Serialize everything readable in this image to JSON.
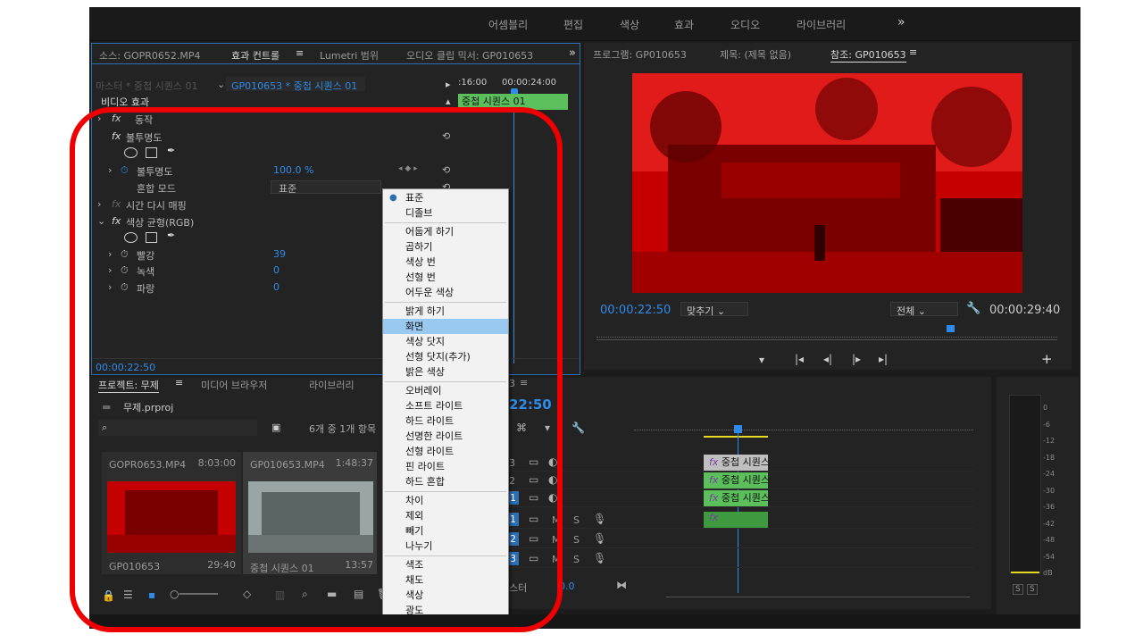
{
  "workspaces": [
    "어셈블리",
    "편집",
    "색상",
    "효과",
    "오디오",
    "라이브러리"
  ],
  "workspaces_more": "»",
  "source_panel": {
    "tabs": [
      "소스: GOPR0652.MP4",
      "효과 컨트롤",
      "Lumetri 범위",
      "오디오 클립 믹서: GP010653"
    ],
    "active_tab_menu": "≡",
    "more": "»",
    "master_label": "마스터 * 중첩 시퀀스 01",
    "sequence_label": "GP010653 * 중첩 시퀀스 01",
    "timecodes": [
      ":16:00",
      "00:00:24:00"
    ],
    "clip_label": "중첩 시퀀스 01",
    "video_effects": "비디오 효과",
    "motion_label": "동작",
    "opacity_section": "불투명도",
    "opacity_param": "불투명도",
    "opacity_value": "100.0 %",
    "blend_mode_label": "혼합 모드",
    "blend_mode_value": "표준",
    "time_remap": "시간 다시 매핑",
    "color_balance": "색상 균형(RGB)",
    "red_label": "빨강",
    "red_value": "39",
    "green_label": "녹색",
    "green_value": "0",
    "blue_label": "파랑",
    "blue_value": "0",
    "current_time": "00:00:22:50"
  },
  "blend_menu": {
    "groups": [
      [
        "표준",
        "디졸브"
      ],
      [
        "어둡게 하기",
        "곱하기",
        "색상 번",
        "선형 번",
        "어두운 색상"
      ],
      [
        "밝게 하기",
        "화면",
        "색상 닷지",
        "선형 닷지(추가)",
        "밝은 색상"
      ],
      [
        "오버레이",
        "소프트 라이트",
        "하드 라이트",
        "선명한 라이트",
        "선형 라이트",
        "핀 라이트",
        "하드 혼합"
      ],
      [
        "차이",
        "제외",
        "빼기",
        "나누기"
      ],
      [
        "색조",
        "채도",
        "색상",
        "광도"
      ]
    ],
    "checked": "표준",
    "highlighted": "화면"
  },
  "program_panel": {
    "tabs": [
      "프로그램: GP010653",
      "제목: (제목 없음)",
      "참조: GP010653"
    ],
    "menu": "≡",
    "timecode": "00:00:22:50",
    "fit": "맞추기",
    "quality": "전체",
    "duration": "00:00:29:40"
  },
  "project_panel": {
    "tabs": [
      "프로젝트: 무제",
      "미디어 브라우저",
      "라이브러리"
    ],
    "menu": "≡",
    "file": "무제.prproj",
    "item_count": "6개 중 1개 항목",
    "items": [
      {
        "name": "GOPR0653.MP4",
        "duration": "8:03:00",
        "label": "GP010653",
        "sub_duration": "29:40"
      },
      {
        "name": "GP010653.MP4",
        "duration": "1:48:37",
        "label": "중첩 시퀀스 01",
        "sub_duration": "13:57"
      }
    ]
  },
  "timeline": {
    "tab_suffix": "3",
    "menu": "≡",
    "timecode": "22:50",
    "video_tracks": [
      "V3",
      "V2",
      "V1"
    ],
    "audio_tracks": [
      "A1",
      "A2",
      "A3"
    ],
    "track_numbers": [
      "3",
      "2",
      "1",
      "1",
      "2",
      "3"
    ],
    "clip_label": "중첩 시퀀스",
    "fx": "fx",
    "mute": "M",
    "solo": "S",
    "master": "스터",
    "master_value": "0.0"
  },
  "meter": {
    "labels": [
      "0",
      "-6",
      "-12",
      "-18",
      "-24",
      "-30",
      "-36",
      "-42",
      "-48",
      "-54",
      "dB"
    ],
    "solo": [
      "S",
      "S"
    ]
  },
  "colors": {
    "accent": "#2d8ceb",
    "annotation": "#ee0000",
    "clip_green": "#5bbf5b",
    "menu_highlight": "#99c9f0"
  }
}
